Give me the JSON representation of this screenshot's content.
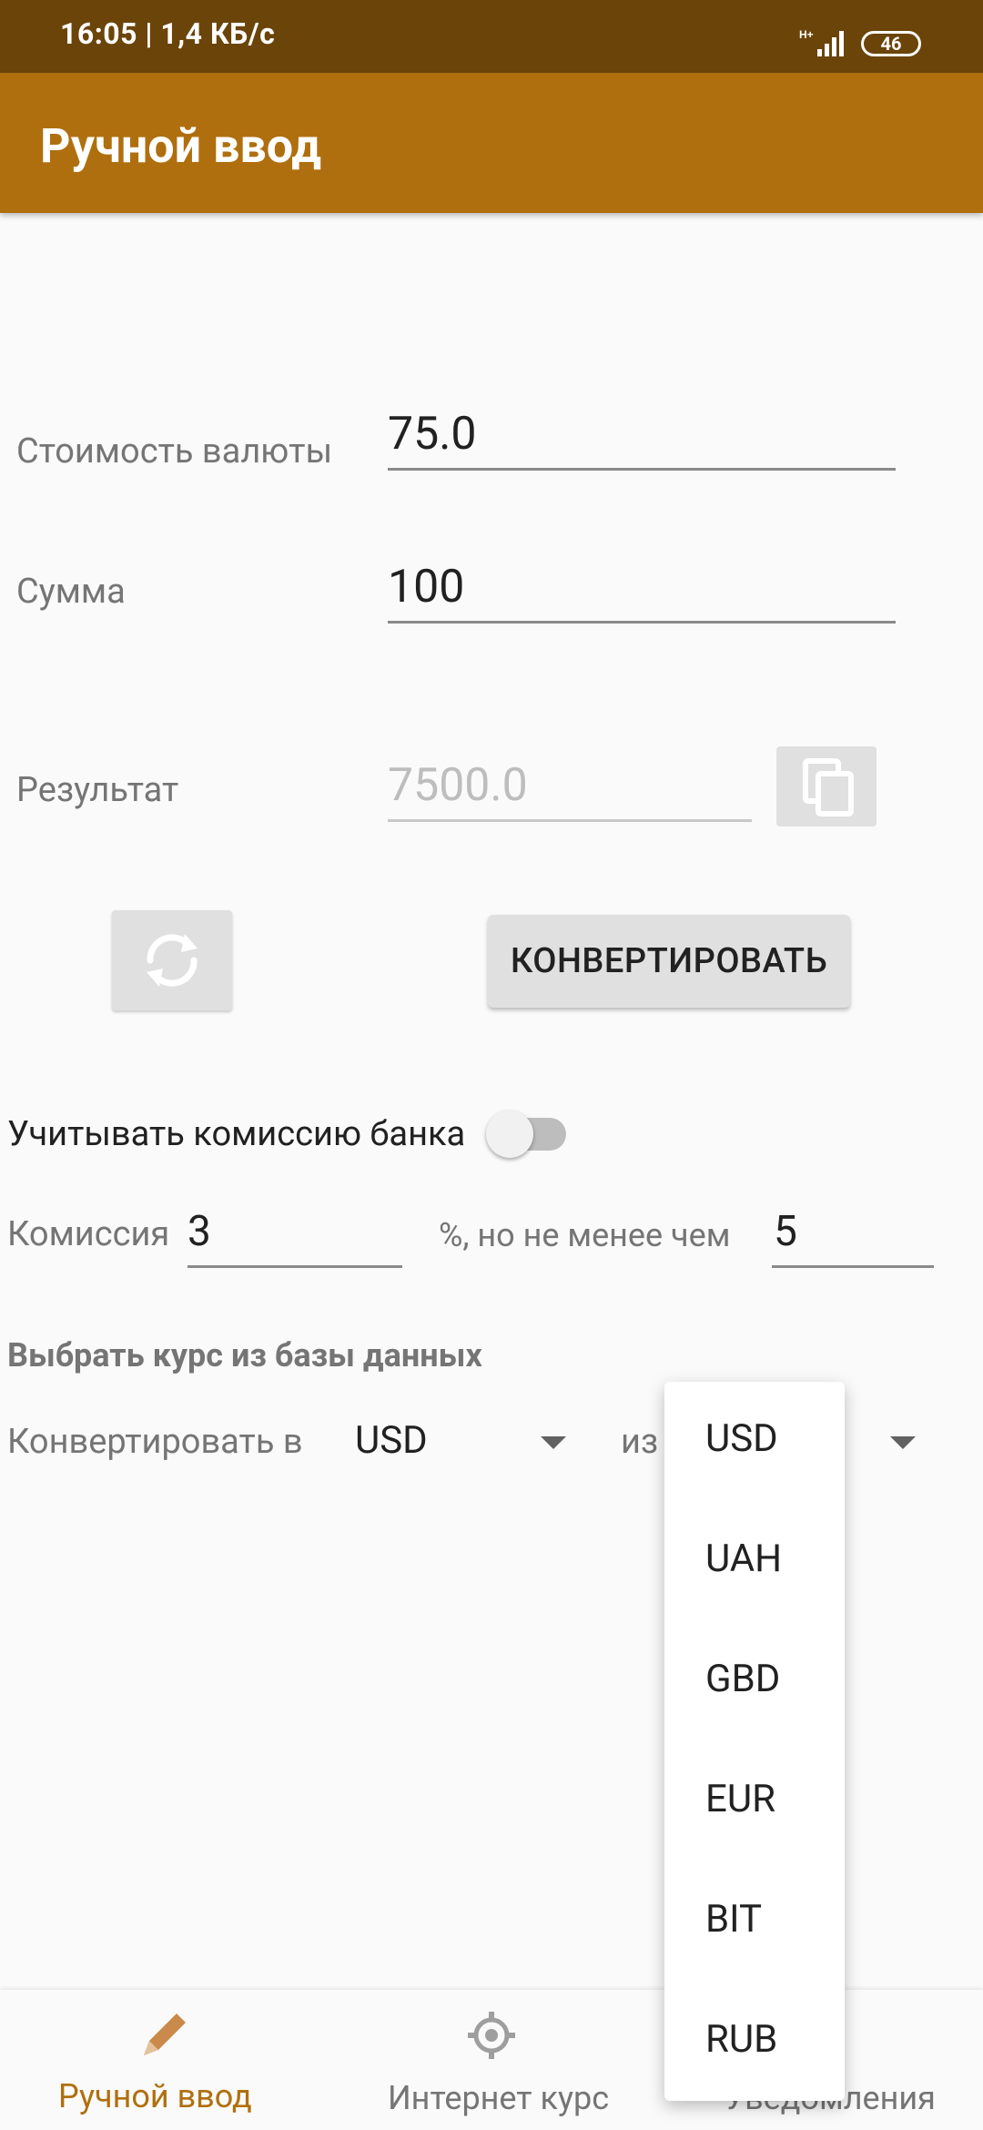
{
  "status_bar": {
    "time": "16:05 | 1,4 КБ/с",
    "battery": "46"
  },
  "app_bar": {
    "title": "Ручной ввод"
  },
  "form": {
    "currency_price_label": "Стоимость валюты",
    "currency_price_value": "75.0",
    "amount_label": "Сумма",
    "amount_value": "100",
    "result_label": "Результат",
    "result_value": "7500.0",
    "convert_button": "КОНВЕРТИРОВАТЬ"
  },
  "commission": {
    "toggle_label": "Учитывать комиссию банка",
    "toggle_on": false,
    "commission_label": "Комиссия",
    "commission_value": "3",
    "min_label": "%, но не менее чем",
    "min_value": "5"
  },
  "database": {
    "section_title": "Выбрать курс из базы данных",
    "convert_to_label": "Конвертировать в",
    "convert_to_value": "USD",
    "from_label": "из"
  },
  "dropdown": {
    "options": [
      "USD",
      "UAH",
      "GBD",
      "EUR",
      "BIT",
      "RUB"
    ]
  },
  "bottom_nav": {
    "items": [
      {
        "label": "Ручной ввод",
        "icon": "pencil-icon",
        "active": true
      },
      {
        "label": "Интернет курс",
        "icon": "crosshair-icon",
        "active": false
      },
      {
        "label": "Уведомления",
        "icon": "bell-icon",
        "active": false
      }
    ]
  },
  "colors": {
    "status_bar": "#6b4409",
    "app_bar": "#b06f0e",
    "accent": "#b06f0e"
  }
}
